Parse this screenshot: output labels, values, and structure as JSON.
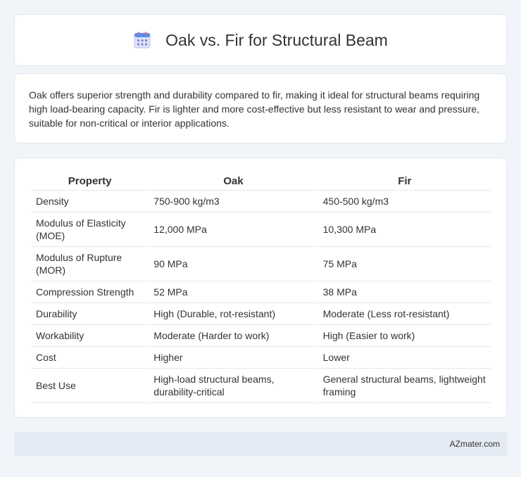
{
  "header": {
    "title": "Oak vs. Fir for Structural Beam",
    "icon": "calendar-icon"
  },
  "summary": {
    "text": "Oak offers superior strength and durability compared to fir, making it ideal for structural beams requiring high load-bearing capacity. Fir is lighter and more cost-effective but less resistant to wear and pressure, suitable for non-critical or interior applications."
  },
  "table": {
    "headers": [
      "Property",
      "Oak",
      "Fir"
    ],
    "rows": [
      [
        "Density",
        "750-900 kg/m3",
        "450-500 kg/m3"
      ],
      [
        "Modulus of Elasticity (MOE)",
        "12,000 MPa",
        "10,300 MPa"
      ],
      [
        "Modulus of Rupture (MOR)",
        "90 MPa",
        "75 MPa"
      ],
      [
        "Compression Strength",
        "52 MPa",
        "38 MPa"
      ],
      [
        "Durability",
        "High (Durable, rot-resistant)",
        "Moderate (Less rot-resistant)"
      ],
      [
        "Workability",
        "Moderate (Harder to work)",
        "High (Easier to work)"
      ],
      [
        "Cost",
        "Higher",
        "Lower"
      ],
      [
        "Best Use",
        "High-load structural beams, durability-critical",
        "General structural beams, lightweight framing"
      ]
    ]
  },
  "footer": {
    "text": "AZmater.com"
  }
}
